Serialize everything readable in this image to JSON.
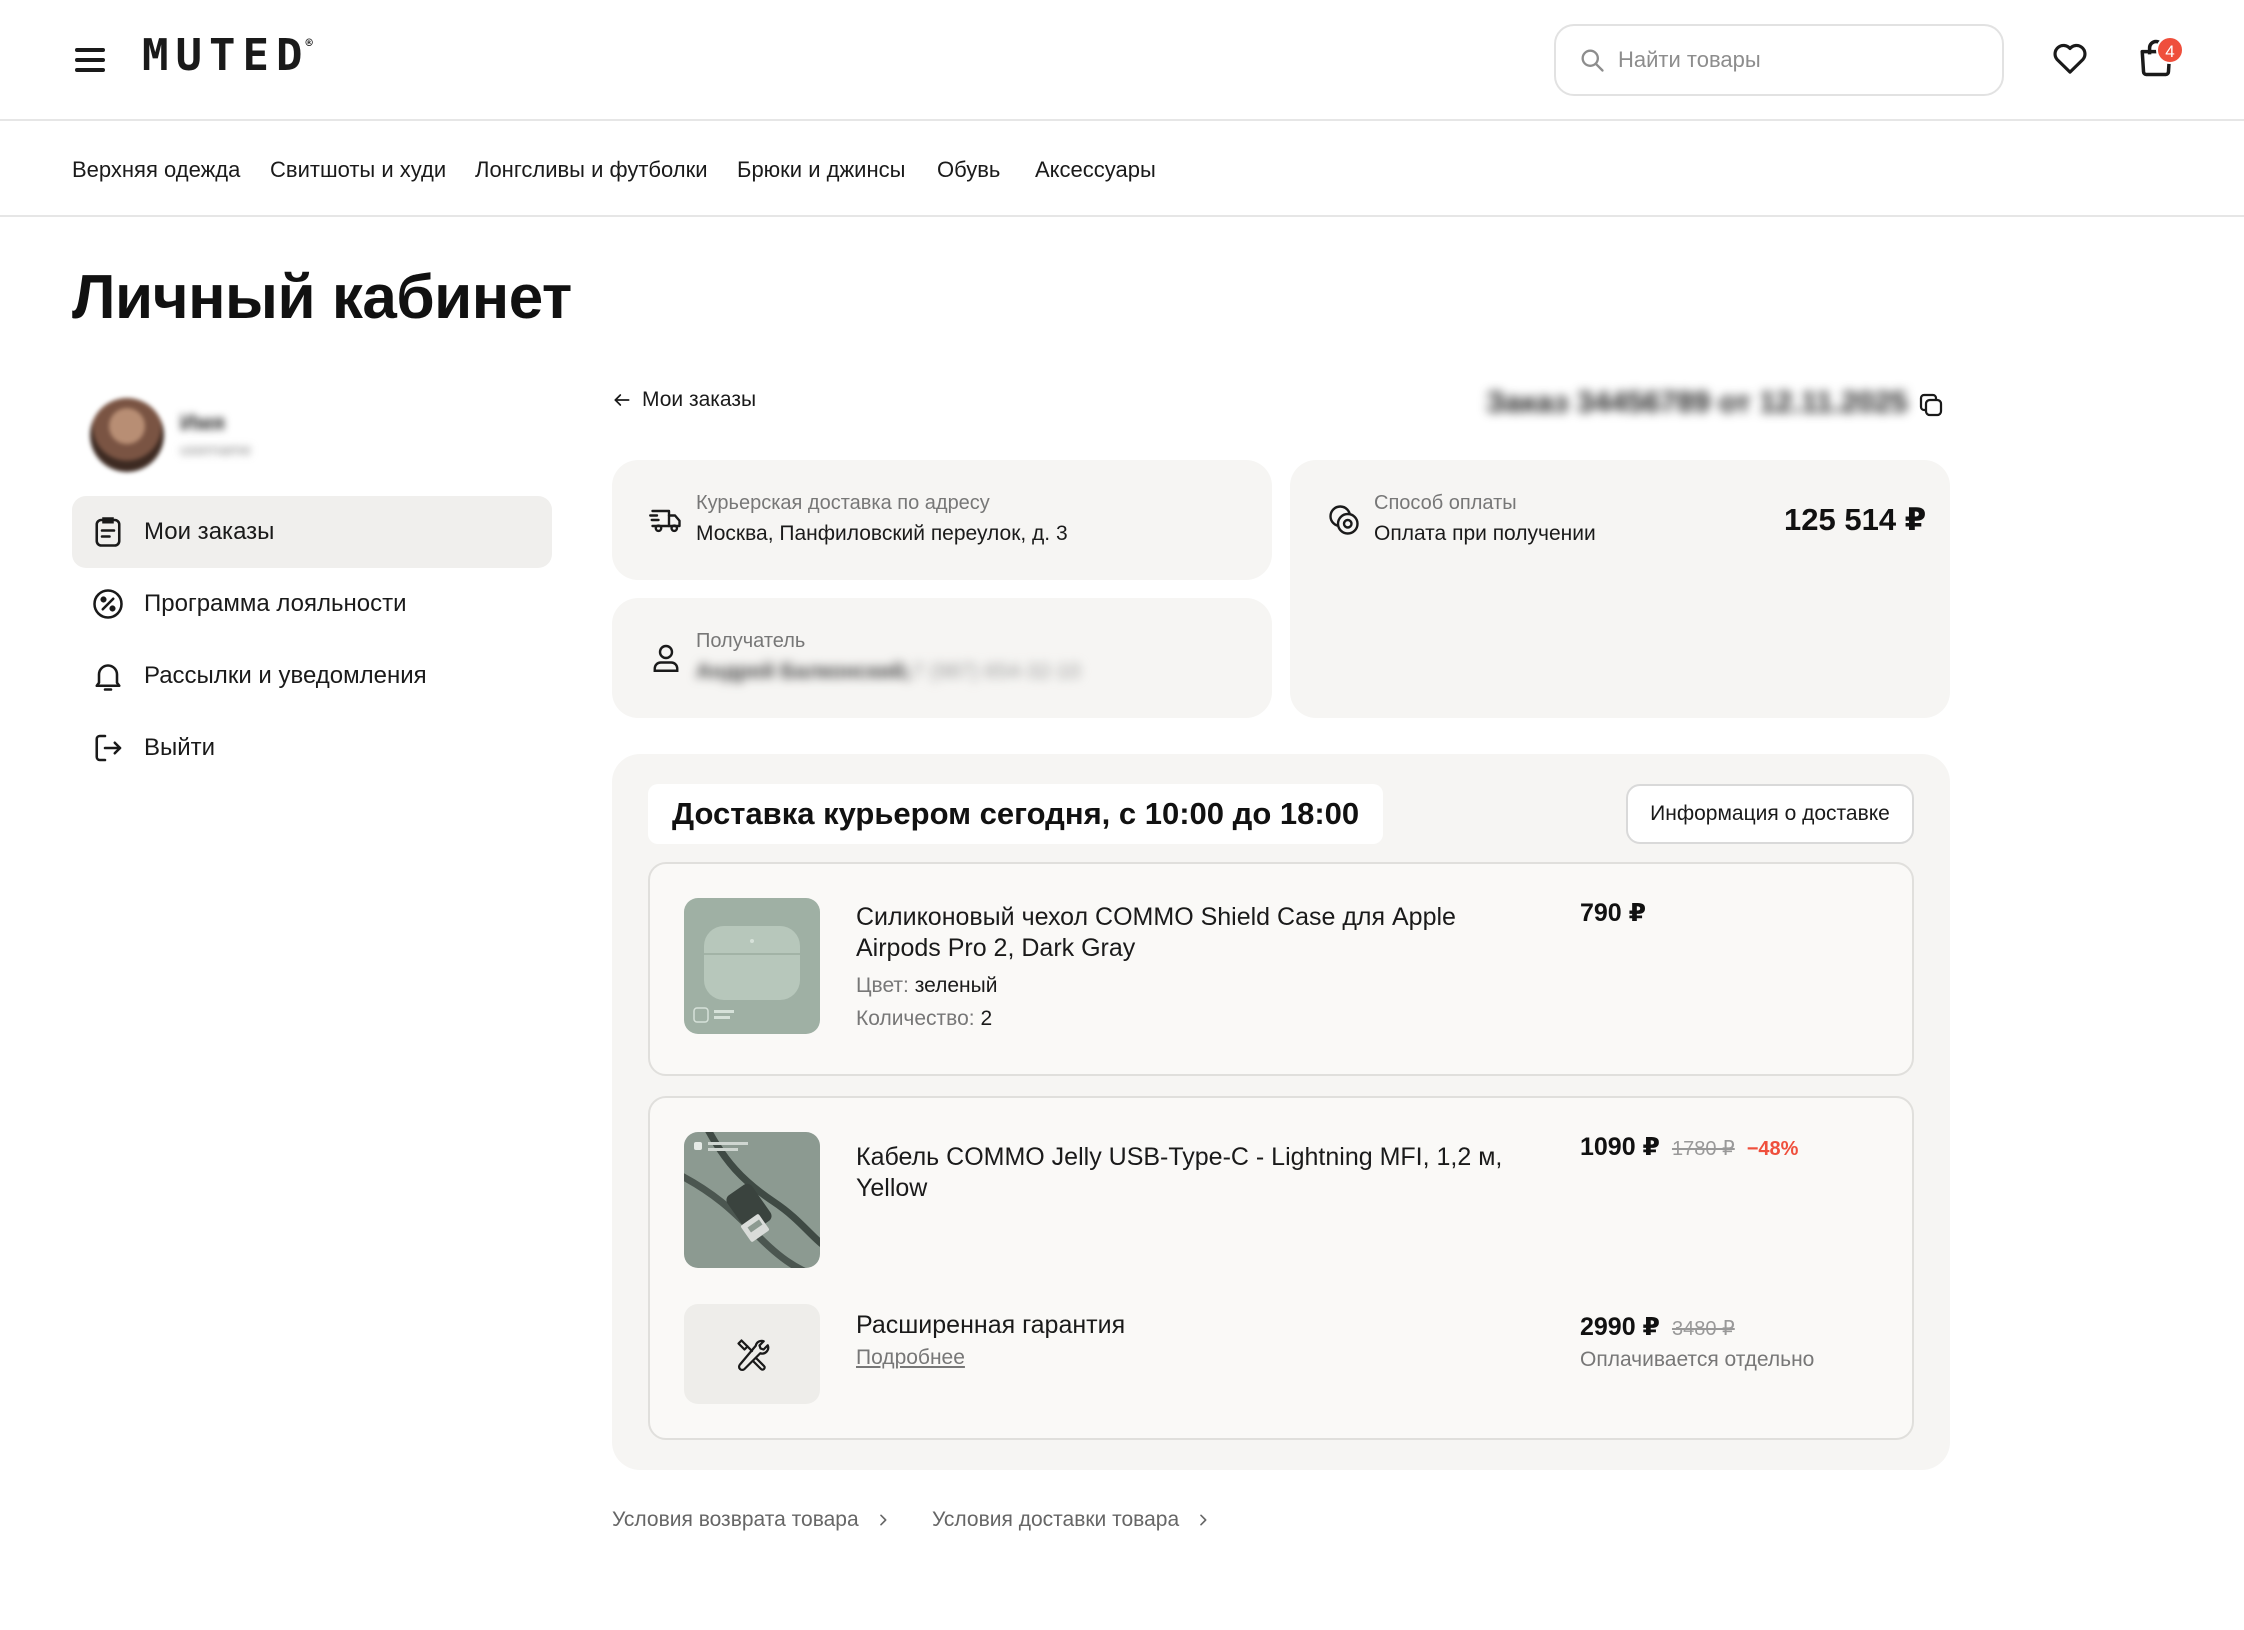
{
  "header": {
    "logo": "MUTED",
    "logo_mark": "®",
    "search_placeholder": "Найти товары",
    "cart_count": "4"
  },
  "categories": [
    "Верхняя одежда",
    "Свитшоты и худи",
    "Лонгсливы и футболки",
    "Брюки и джинсы",
    "Обувь",
    "Аксессуары"
  ],
  "page_title": "Личный кабинет",
  "profile": {
    "name": "Имя",
    "handle": "username"
  },
  "sidebar": {
    "items": [
      {
        "label": "Мои заказы",
        "icon": "orders-icon",
        "active": true
      },
      {
        "label": "Программа лояльности",
        "icon": "percent-icon",
        "active": false
      },
      {
        "label": "Рассылки и уведомления",
        "icon": "bell-icon",
        "active": false
      },
      {
        "label": "Выйти",
        "icon": "logout-icon",
        "active": false
      }
    ]
  },
  "order": {
    "back_label": "Мои заказы",
    "title": "Заказ 34456789 от 12.11.2025",
    "delivery": {
      "label": "Курьерская доставка по адресу",
      "address": "Москва, Панфиловский переулок, д. 3"
    },
    "recipient": {
      "label": "Получатель",
      "name": "Андрей Балконский,",
      "phone": "+7 (987) 654-32-10"
    },
    "payment": {
      "label": "Способ оплаты",
      "method": "Оплата при получении",
      "total": "125 514 ₽"
    }
  },
  "shipment": {
    "title": "Доставка курьером сегодня, с 10:00 до 18:00",
    "info_button": "Информация о доставке",
    "items": [
      {
        "name": "Силиконовый чехол COMMO Shield Case для Apple Airpods Pro 2, Dark Gray",
        "color_label": "Цвет:",
        "color_value": "зеленый",
        "qty_label": "Количество:",
        "qty_value": "2",
        "price": "790 ₽"
      },
      {
        "name": "Кабель COMMO Jelly USB-Type-C - Lightning MFI, 1,2 м, Yellow",
        "price": "1090 ₽",
        "old_price": "1780 ₽",
        "discount": "−48%"
      }
    ],
    "warranty": {
      "name": "Расширенная гарантия",
      "link": "Подробнее",
      "price": "2990 ₽",
      "old_price": "3480 ₽",
      "note": "Оплачивается отдельно"
    }
  },
  "footer_links": [
    "Условия возврата товара",
    "Условия доставки товара"
  ],
  "colors": {
    "accent_red": "#ef4f3c",
    "card_bg": "#f6f5f3",
    "text": "#1a1a1a",
    "muted_text": "#777777"
  }
}
